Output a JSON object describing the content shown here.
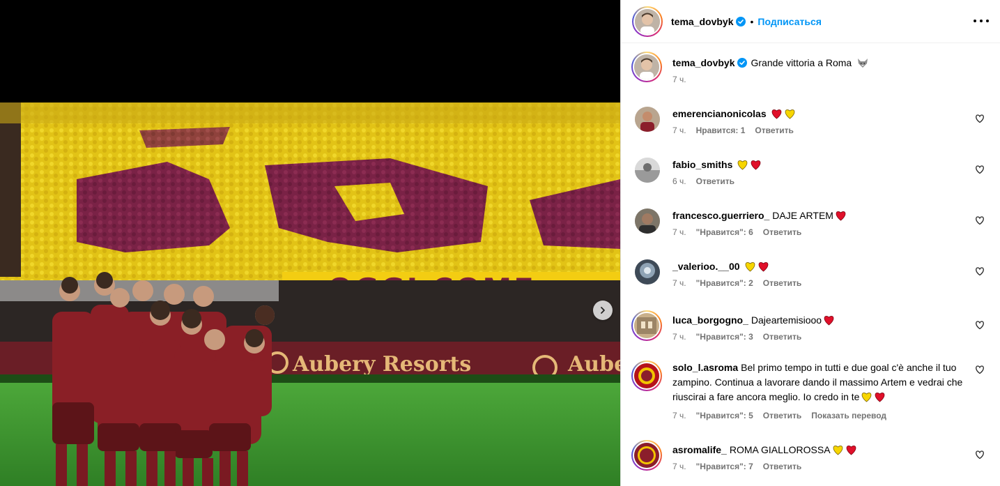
{
  "post": {
    "author": "tema_dovbyk",
    "follow_label": "Подписаться",
    "separator": "•",
    "caption_text": "Grande vittoria a Roma",
    "caption_emoji": "wolf-emoji",
    "caption_time": "7 ч."
  },
  "photo": {
    "banner_text": "OGGI COME",
    "ad_text_1": "Aubery Resorts",
    "ad_text_2": "Auber"
  },
  "comments": [
    {
      "user": "emerencianonicolas",
      "text": "",
      "hearts": [
        "red",
        "yellow"
      ],
      "time": "7 ч.",
      "likes": "Нравится: 1",
      "reply": "Ответить",
      "translate": ""
    },
    {
      "user": "fabio_smiths",
      "text": "",
      "hearts": [
        "yellow",
        "red"
      ],
      "time": "6 ч.",
      "likes": "",
      "reply": "Ответить",
      "translate": ""
    },
    {
      "user": "francesco.guerriero_",
      "text": "DAJE ARTEM",
      "hearts": [
        "red"
      ],
      "time": "7 ч.",
      "likes": "\"Нравится\": 6",
      "reply": "Ответить",
      "translate": ""
    },
    {
      "user": "_valerioo.__00",
      "text": "",
      "hearts": [
        "yellow",
        "red"
      ],
      "time": "7 ч.",
      "likes": "\"Нравится\": 2",
      "reply": "Ответить",
      "translate": ""
    },
    {
      "user": "luca_borgogno_",
      "text": "Dajeartemisiooo",
      "hearts": [
        "red"
      ],
      "time": "7 ч.",
      "likes": "\"Нравится\": 3",
      "reply": "Ответить",
      "translate": ""
    },
    {
      "user": "solo_l.asroma",
      "text": "Bel primo tempo in tutti e due goal c'è anche il tuo zampino. Continua a lavorare dando il massimo Artem e vedrai che riuscirai a fare ancora meglio. Io credo in te",
      "hearts": [
        "yellow",
        "red"
      ],
      "time": "7 ч.",
      "likes": "\"Нравится\": 5",
      "reply": "Ответить",
      "translate": "Показать перевод"
    },
    {
      "user": "asromalife_",
      "text": "ROMA GIALLOROSSA",
      "hearts": [
        "yellow",
        "red"
      ],
      "time": "7 ч.",
      "likes": "\"Нравится\": 7",
      "reply": "Ответить",
      "translate": ""
    }
  ],
  "colors": {
    "accent": "#0095f6",
    "roma_red": "#8b1e2b",
    "roma_yellow": "#f2c500",
    "meta_gray": "#737373"
  }
}
